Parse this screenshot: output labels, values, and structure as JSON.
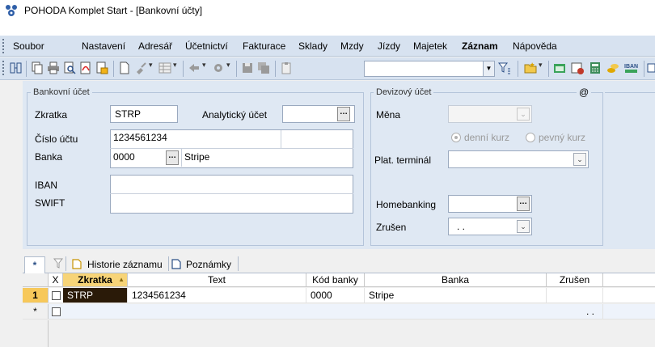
{
  "window": {
    "title": "POHODA Komplet Start - [Bankovní účty]"
  },
  "menu": {
    "items": [
      "Soubor",
      "Nastavení",
      "Adresář",
      "Účetnictví",
      "Fakturace",
      "Sklady",
      "Mzdy",
      "Jízdy",
      "Majetek",
      "Záznam",
      "Nápověda"
    ]
  },
  "toolbar": {
    "search_value": "",
    "icons": [
      "agenda-switch-icon",
      "copy-icon",
      "print-icon",
      "print-preview-icon",
      "pdf-icon",
      "print-settings-icon",
      "new-record-icon",
      "brush-icon",
      "grid-view-icon",
      "back-arrow-icon",
      "gear-icon",
      "save-icon",
      "save-all-icon",
      "clipboard-icon",
      "filter-icon",
      "folder-icon",
      "calendar-icon",
      "tables-icon",
      "calculator-icon",
      "coins-icon",
      "iban-icon"
    ]
  },
  "bank_group": {
    "title": "Bankovní účet",
    "zkratka_label": "Zkratka",
    "zkratka_value": "STRP",
    "analyticky_label": "Analytický účet",
    "analyticky_value": "",
    "cislo_label": "Číslo účtu",
    "cislo_value": "1234561234",
    "cislo_suffix": "",
    "banka_label": "Banka",
    "banka_code": "0000",
    "banka_name": "Stripe",
    "iban_label": "IBAN",
    "iban_value": "",
    "swift_label": "SWIFT",
    "swift_value": ""
  },
  "foreign_group": {
    "title": "Devizový účet",
    "at_symbol": "@",
    "mena_label": "Měna",
    "mena_value": "",
    "radio_daily": "denní kurz",
    "radio_fixed": "pevný kurz",
    "terminal_label": "Plat. terminál",
    "terminal_value": "",
    "homebanking_label": "Homebanking",
    "homebanking_value": "",
    "zrusen_label": "Zrušen",
    "zrusen_value": ". ."
  },
  "tabs": {
    "star": "*",
    "history": "Historie záznamu",
    "notes": "Poznámky"
  },
  "grid": {
    "columns": [
      "X",
      "Zkratka",
      "Text",
      "Kód banky",
      "Banka",
      "Zrušen"
    ],
    "rows": [
      {
        "num": "1",
        "zkratka": "STRP",
        "text": "1234561234",
        "kod": "0000",
        "banka": "Stripe",
        "zrusen": ""
      }
    ],
    "new_row": {
      "num": "*",
      "zrusen": ". ."
    }
  },
  "colors": {
    "menubar": "#d7e2f0",
    "form_bg": "#dfe8f3",
    "selected_cell": "#2a1a08",
    "sort_header": "#f7d478",
    "row_num_active": "#f7c85a"
  }
}
